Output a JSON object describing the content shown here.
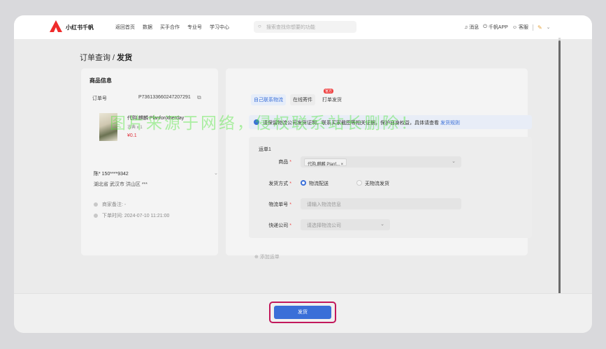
{
  "header": {
    "brand": "小红书千帆",
    "nav": [
      "返回首页",
      "数据",
      "买手合作",
      "专业号",
      "学习中心"
    ],
    "search_placeholder": "搜索查找你想要的功能",
    "messages": "消息",
    "app": "千帆APP",
    "service": "客服"
  },
  "page": {
    "crumb": "订单查询 / ",
    "title": "发货"
  },
  "product_panel": {
    "heading": "商品信息",
    "order_label": "订单号",
    "order_no": "P736133660247207291",
    "product_name": "代购,麒麟 Planforotherday",
    "product_spec": "古典  x 1",
    "product_price": "¥0.1",
    "buyer": "陈* 150****9342",
    "address": "湖北省 武汉市 洪山区 ***",
    "merchant_note": "商家备注: -",
    "order_time": "下单时间: 2024-07-10 11:21:00"
  },
  "shipping": {
    "tabs": [
      "自己联系物流",
      "在线寄件",
      "打单发货"
    ],
    "badge": "官方",
    "alert_text": "请保留物流公司发货证明，联系买家截图等相关证据，保护自身权益，具体请查看",
    "alert_link": "发货规则",
    "waybill_title": "运单1",
    "field_product": "商品",
    "product_chip": "代购,麒麟 Planf... ×",
    "field_method": "发货方式",
    "method_options": [
      "物流配送",
      "无物流发货"
    ],
    "field_tracking": "物流单号",
    "tracking_placeholder": "请输入物流信息",
    "field_courier": "快递公司",
    "courier_placeholder": "请选择物流公司",
    "add_bill": "⊕ 添加运单"
  },
  "watermark": "图片来源于网络，侵权联系站长删除！",
  "footer": {
    "ship_button": "发货"
  },
  "colors": {
    "accent": "#3a6fd8",
    "highlight_frame": "#c2185b",
    "brand_red": "#ef2b2b"
  }
}
